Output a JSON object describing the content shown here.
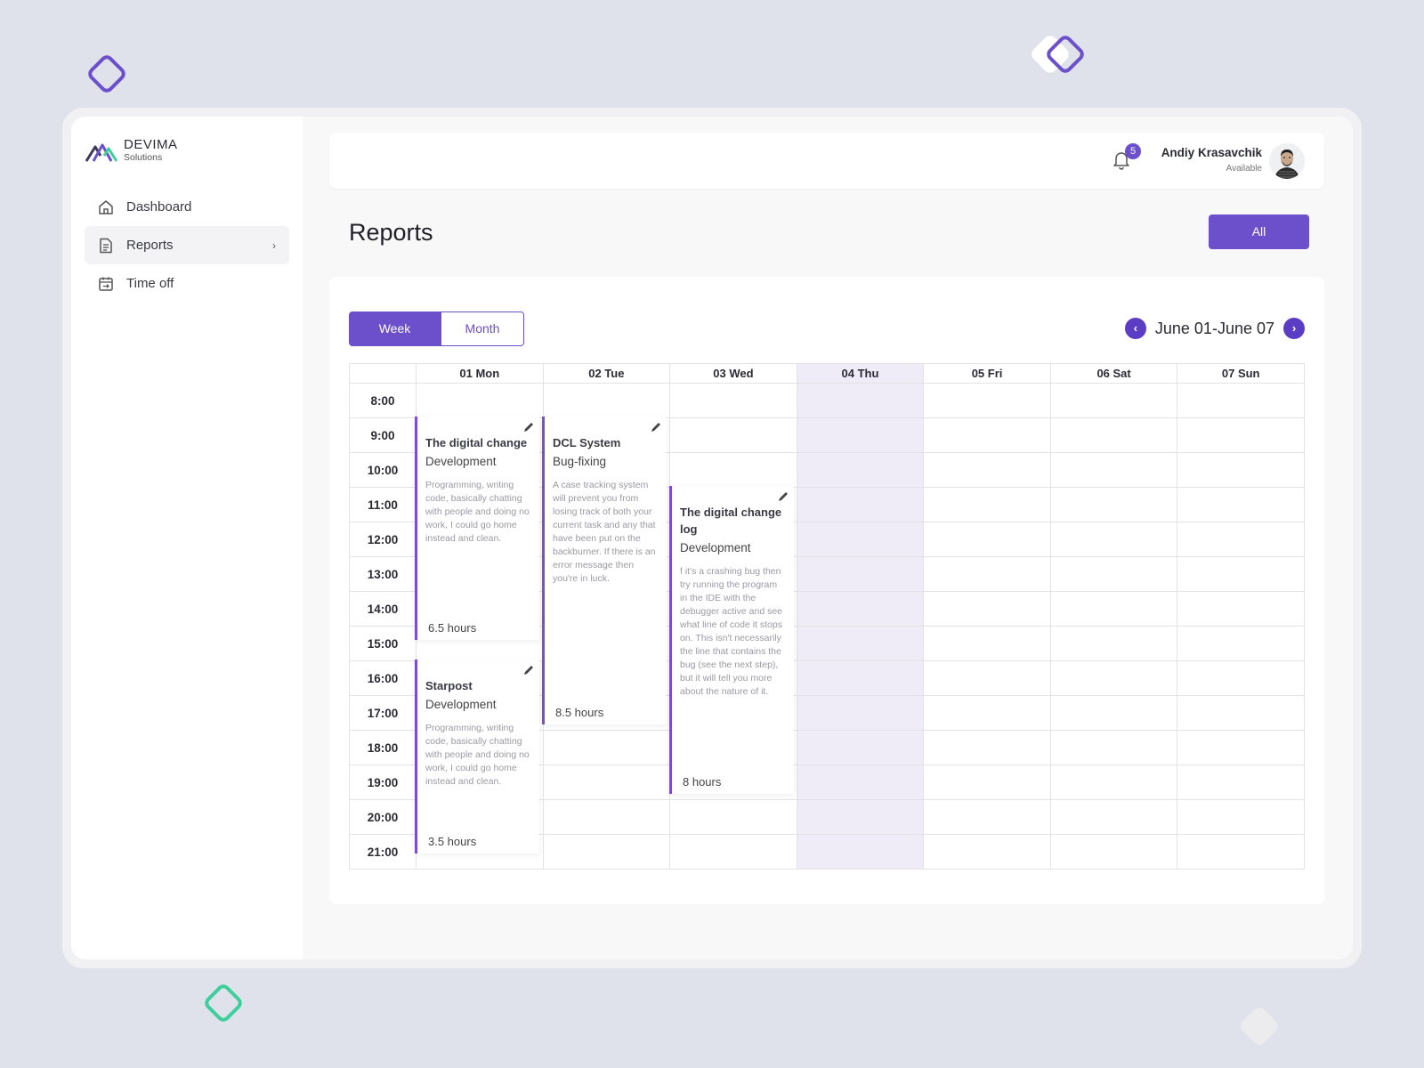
{
  "brand": {
    "name": "DEVIMA",
    "sub": "Solutions"
  },
  "sidebar": {
    "items": [
      {
        "label": "Dashboard",
        "icon": "home-icon"
      },
      {
        "label": "Reports",
        "icon": "document-icon",
        "active": true
      },
      {
        "label": "Time off",
        "icon": "calendar-icon"
      }
    ]
  },
  "header": {
    "notifications": "5",
    "user_name": "Andiy Krasavchik",
    "user_status": "Available"
  },
  "page": {
    "title": "Reports",
    "filter_button": "All"
  },
  "calendar": {
    "view_week": "Week",
    "view_month": "Month",
    "range": "June 01-June 07",
    "days": [
      "01 Mon",
      "02 Tue",
      "03 Wed",
      "04 Thu",
      "05 Fri",
      "06 Sat",
      "07 Sun"
    ],
    "highlight_day": "04 Thu",
    "times": [
      "8:00",
      "9:00",
      "10:00",
      "11:00",
      "12:00",
      "13:00",
      "14:00",
      "15:00",
      "16:00",
      "17:00",
      "18:00",
      "19:00",
      "20:00",
      "21:00"
    ],
    "events": [
      {
        "title": "The digital change",
        "category": "Development",
        "description": "Programming, writing code, basically chatting with people and doing no work, I could go home instead and clean.",
        "hours": "6.5 hours"
      },
      {
        "title": "DCL System",
        "category": "Bug-fixing",
        "description": "A case tracking system will prevent you from losing track of both your current task and any that have been put on the backburner. If there is an error message then you're in luck.",
        "hours": "8.5 hours"
      },
      {
        "title": "The digital change log",
        "category": "Development",
        "description": "f it's a crashing bug then try running the program in the IDE with the debugger active and see what line of code it stops on. This isn't necessarily the line that contains the bug (see the next step), but it will tell you more about the nature of it.",
        "hours": "8 hours"
      },
      {
        "title": "Starpost",
        "category": "Development",
        "description": "Programming, writing code, basically chatting with people and doing no work, I could go home instead and clean.",
        "hours": "3.5 hours"
      }
    ]
  },
  "colors": {
    "accent": "#6b4fcb",
    "today_bg": "#efecf8",
    "page_bg": "#e0e2eb"
  }
}
